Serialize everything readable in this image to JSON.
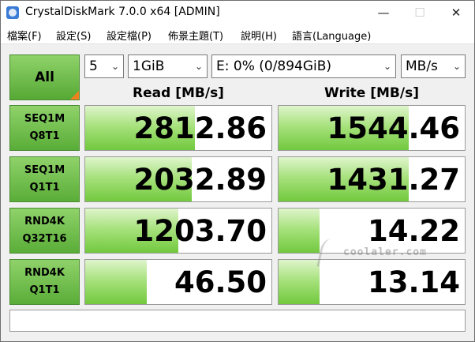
{
  "window": {
    "title": "CrystalDiskMark 7.0.0 x64 [ADMIN]",
    "minimize_glyph": "—",
    "maximize_glyph": "☐",
    "close_glyph": "✕",
    "app_icon": "crystaldiskmark-icon"
  },
  "menu": [
    {
      "label": "檔案(F)"
    },
    {
      "label": "設定(S)"
    },
    {
      "label": "設定檔(P)"
    },
    {
      "label": "佈景主題(T)"
    },
    {
      "label": "說明(H)"
    },
    {
      "label": "語言(Language)"
    }
  ],
  "controls": {
    "all_label": "All",
    "count": "5",
    "size": "1GiB",
    "drive": "E: 0% (0/894GiB)",
    "unit": "MB/s",
    "chevron": "⌄"
  },
  "headers": {
    "read": "Read [MB/s]",
    "write": "Write [MB/s]"
  },
  "tests": [
    {
      "line1": "SEQ1M",
      "line2": "Q8T1",
      "read": "2812.86",
      "read_fill": 0.59,
      "write": "1544.46",
      "write_fill": 0.7
    },
    {
      "line1": "SEQ1M",
      "line2": "Q1T1",
      "read": "2032.89",
      "read_fill": 0.57,
      "write": "1431.27",
      "write_fill": 0.7
    },
    {
      "line1": "RND4K",
      "line2": "Q32T16",
      "read": "1203.70",
      "read_fill": 0.5,
      "write": "14.22",
      "write_fill": 0.22
    },
    {
      "line1": "RND4K",
      "line2": "Q1T1",
      "read": "46.50",
      "read_fill": 0.33,
      "write": "13.14",
      "write_fill": 0.22
    }
  ],
  "comment": "",
  "watermark": {
    "text": "coolaler.com"
  },
  "colors": {
    "accent_green": "#72c93e",
    "corner_orange": "#f0821e"
  }
}
